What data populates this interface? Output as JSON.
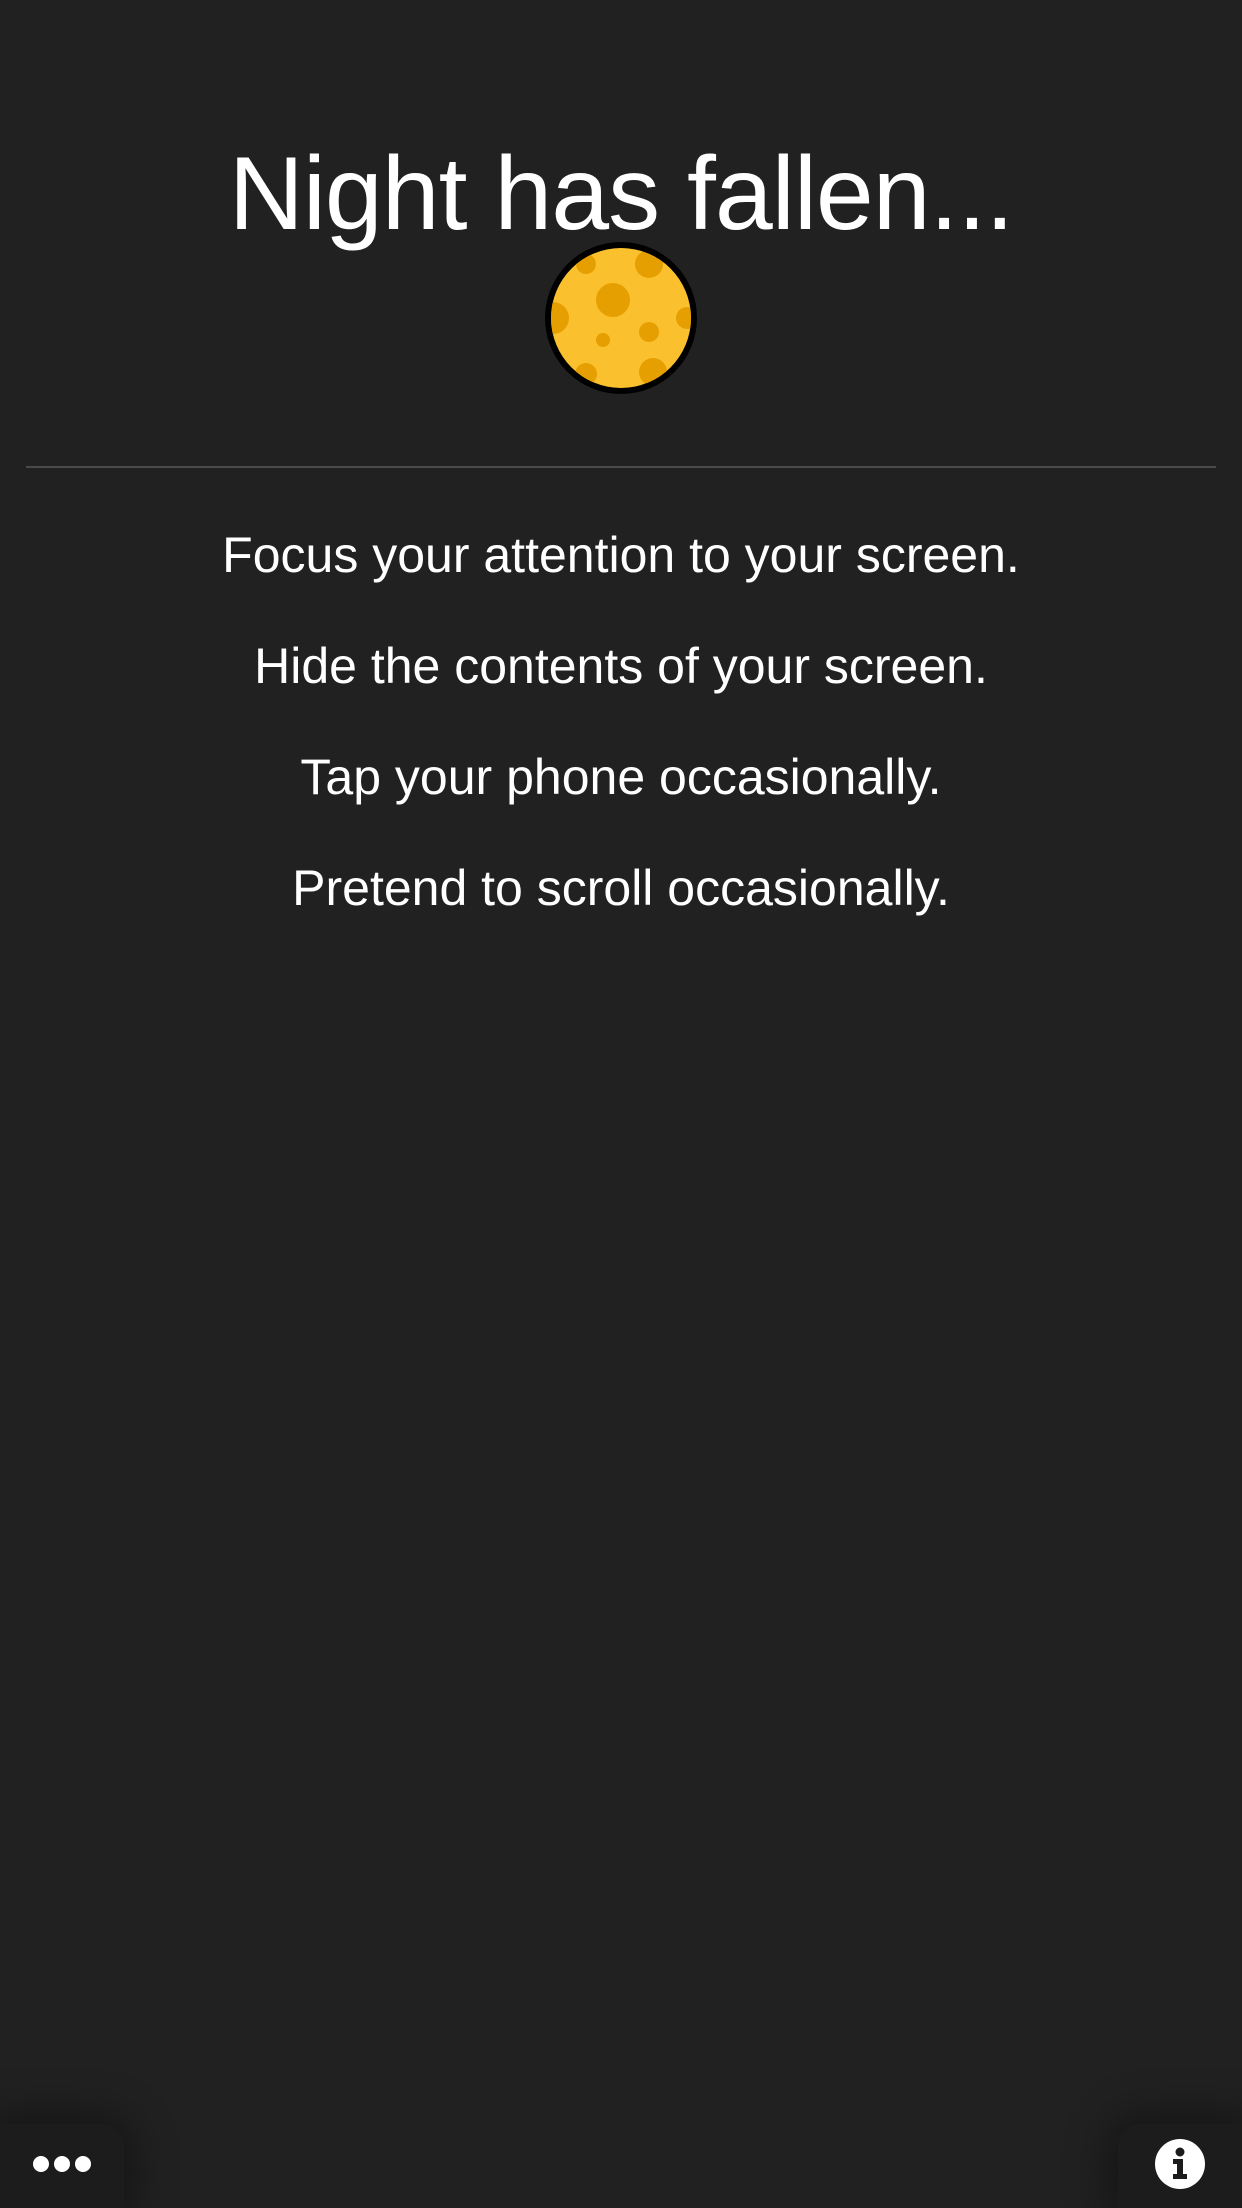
{
  "screen": {
    "title": "Night has fallen...",
    "phase_icon": "moon-icon"
  },
  "instructions": [
    "Focus your attention to your screen.",
    "Hide the contents of your screen.",
    "Tap your phone occasionally.",
    "Pretend to scroll occasionally."
  ],
  "footer": {
    "menu_icon": "more-dots-icon",
    "info_icon": "info-icon"
  },
  "colors": {
    "background": "#212121",
    "text": "#ffffff",
    "moon_fill": "#fbc02d",
    "moon_craters": "#e69f00",
    "moon_outline": "#000000"
  }
}
